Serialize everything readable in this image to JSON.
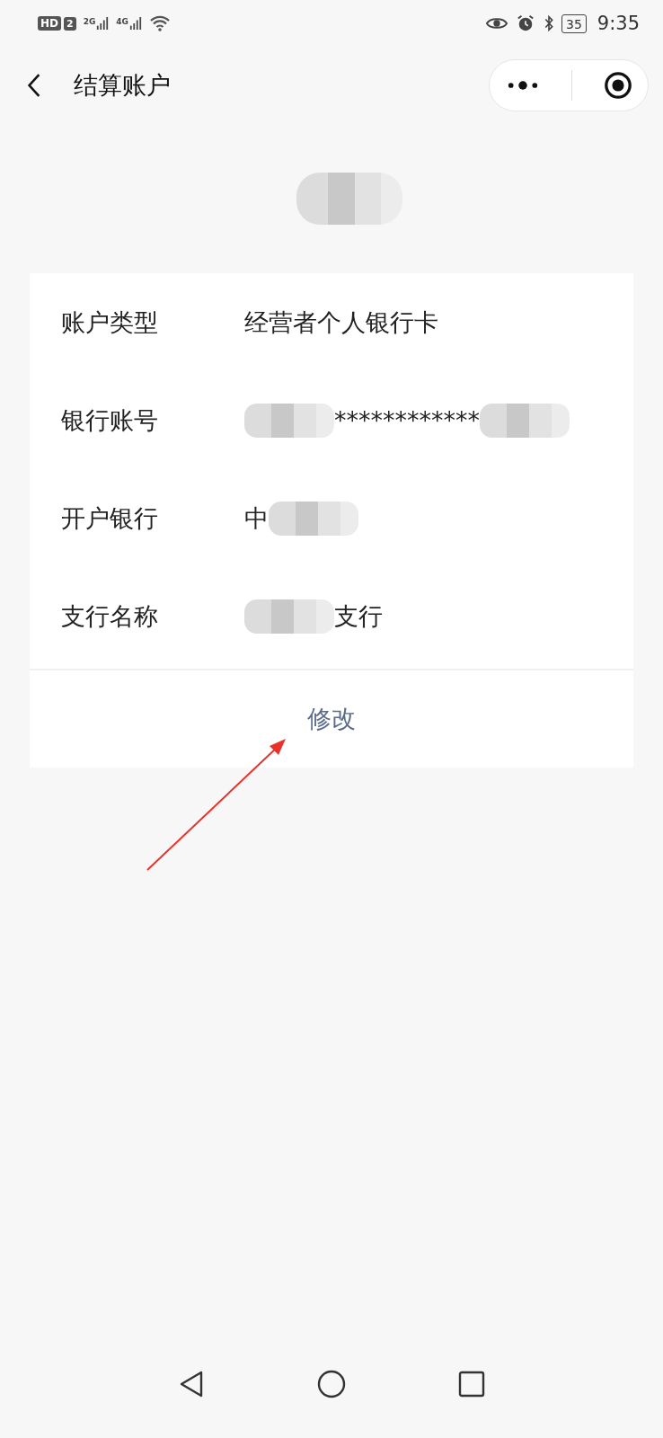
{
  "status_bar": {
    "hd": "HD",
    "sim": "2",
    "networks": [
      "2G",
      "4G"
    ],
    "battery": "35",
    "time": "9:35"
  },
  "nav": {
    "title": "结算账户"
  },
  "account_name": [
    {
      "kind": "mosaic"
    }
  ],
  "rows": [
    {
      "label": "账户类型",
      "value": [
        {
          "kind": "text",
          "text": "经营者个人银行卡"
        }
      ]
    },
    {
      "label": "银行账号",
      "value": [
        {
          "kind": "mosaic"
        },
        {
          "kind": "text",
          "text": "************"
        },
        {
          "kind": "mosaic"
        }
      ]
    },
    {
      "label": "开户银行",
      "value": [
        {
          "kind": "text",
          "text": "中"
        },
        {
          "kind": "mosaic"
        }
      ]
    },
    {
      "label": "支行名称",
      "value": [
        {
          "kind": "mosaic"
        },
        {
          "kind": "text",
          "text": "支行"
        }
      ]
    }
  ],
  "action": "修改",
  "annotation": {
    "kind": "arrow"
  }
}
